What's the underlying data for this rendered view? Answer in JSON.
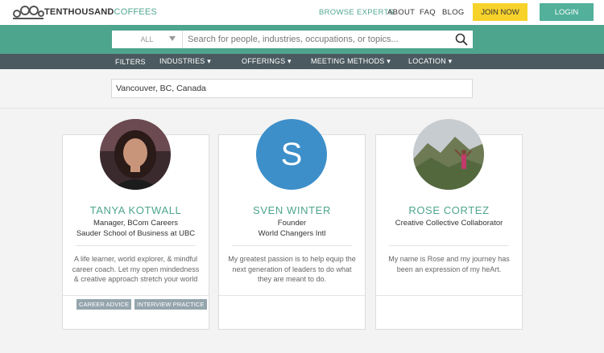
{
  "header": {
    "logo_bold": "TENTHOUSAND",
    "logo_light": "COFFEES",
    "nav": {
      "browse": "BROWSE EXPERTS",
      "about": "ABOUT",
      "faq": "FAQ",
      "blog": "BLOG"
    },
    "join_label": "JOIN NOW",
    "login_label": "LOGIN"
  },
  "search": {
    "category": "ALL",
    "placeholder": "Search for people, industries, occupations, or topics...",
    "value": ""
  },
  "filters": {
    "filters": "FILTERS",
    "industries": "INDUSTRIES ▾",
    "offerings": "OFFERINGS ▾",
    "methods": "MEETING METHODS ▾",
    "location": "LOCATION ▾"
  },
  "location": {
    "value": "Vancouver, BC, Canada"
  },
  "cards": [
    {
      "name": "TANYA KOTWALL",
      "role_line1": "Manager, BCom Careers",
      "role_line2": "Sauder School of Business at UBC",
      "bio": "A life learner, world explorer, & mindful career coach. Let my open mindedness & creative approach stretch your world of",
      "tags": [
        "CAREER ADVICE",
        "INTERVIEW PRACTICE"
      ]
    },
    {
      "name": "SVEN WINTER",
      "initial": "S",
      "role_line1": "Founder",
      "role_line2": "World Changers Intl",
      "bio": "My greatest passion is to help equip the next generation of leaders to do what they are meant to do.",
      "tags": []
    },
    {
      "name": "ROSE CORTEZ",
      "role_line1": "Creative Collective Collaborator",
      "role_line2": "",
      "bio": "My name is Rose and my journey has been an expression of my heArt.",
      "tags": []
    }
  ],
  "colors": {
    "brand_green": "#4ea58e",
    "join_yellow": "#f7d22b",
    "filter_bar": "#4b5a60",
    "avatar_blue": "#3d8fc9",
    "tag_gray": "#95a5ad"
  }
}
